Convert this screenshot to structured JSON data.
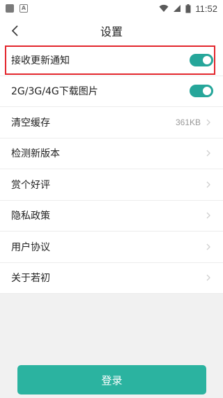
{
  "status_bar": {
    "time": "11:52",
    "icons": [
      "app-square-icon",
      "a-icon",
      "wifi-icon",
      "signal-icon",
      "battery-icon"
    ]
  },
  "header": {
    "title": "设置",
    "back_icon": "chevron-left-icon"
  },
  "settings": [
    {
      "label": "接收更新通知",
      "toggle": true
    },
    {
      "label": "2G/3G/4G下载图片",
      "toggle": true
    },
    {
      "label": "清空缓存",
      "value": "361KB"
    },
    {
      "label": "检测新版本"
    },
    {
      "label": "赏个好评"
    },
    {
      "label": "隐私政策"
    },
    {
      "label": "用户协议"
    },
    {
      "label": "关于若初"
    }
  ],
  "login": {
    "label": "登录"
  },
  "colors": {
    "accent": "#26a69a",
    "button": "#2bb3a0",
    "highlight": "#e3262d"
  }
}
